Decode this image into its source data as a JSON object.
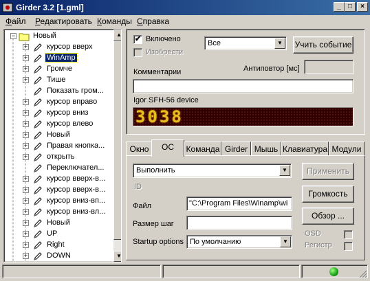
{
  "window": {
    "title": "Girder 3.2 [1.gml]",
    "minimize": "_",
    "maximize": "□",
    "close": "×"
  },
  "menu": [
    "Файл",
    "Редактировать",
    "Команды",
    "Справка"
  ],
  "tree": {
    "root": "Новый",
    "items": [
      {
        "label": "курсор вверх",
        "expandable": true
      },
      {
        "label": "WinAmp",
        "expandable": true,
        "selected": true
      },
      {
        "label": "Громче",
        "expandable": true
      },
      {
        "label": "Тише",
        "expandable": true
      },
      {
        "label": "Показать гром...",
        "expandable": false
      },
      {
        "label": "курсор вправо",
        "expandable": true
      },
      {
        "label": "курсор вниз",
        "expandable": true
      },
      {
        "label": "курсор влево",
        "expandable": true
      },
      {
        "label": "Новый",
        "expandable": true
      },
      {
        "label": "Правая кнопка...",
        "expandable": true
      },
      {
        "label": "открыть",
        "expandable": true
      },
      {
        "label": "Переключател...",
        "expandable": false
      },
      {
        "label": "курсор вверх-в...",
        "expandable": true
      },
      {
        "label": "курсор вверх-в...",
        "expandable": true
      },
      {
        "label": "курсор вниз-вп...",
        "expandable": true
      },
      {
        "label": "курсор вниз-вл...",
        "expandable": true
      },
      {
        "label": "Новый",
        "expandable": true
      },
      {
        "label": "UP",
        "expandable": true
      },
      {
        "label": "Right",
        "expandable": true
      },
      {
        "label": "DOWN",
        "expandable": true
      }
    ]
  },
  "top_panel": {
    "enabled_label": "Включено",
    "enabled_checked": "✔",
    "invert_label": "Изобрести",
    "device_combo": "Все",
    "learn_button": "Учить событие",
    "comments_label": "Комментарии",
    "repeat_label": "Антиповтор [мс]",
    "device_name": "Igor SFH-56 device",
    "led_code": "3038"
  },
  "tabs": [
    "Окно",
    "ОС",
    "Команда",
    "Girder",
    "Мышь",
    "Клавиатура",
    "Модули"
  ],
  "active_tab": "ОС",
  "os_panel": {
    "action_combo": "Выполнить",
    "id_label": "ID",
    "apply_button": "Применить",
    "volume_button": "Громкость",
    "file_label": "Файл",
    "file_value": "\"C:\\Program Files\\Winamp\\wi",
    "browse_button": "Обзор ...",
    "step_label": "Размер шаг",
    "osd_label": "OSD",
    "startup_label": "Startup options",
    "startup_combo": "По умолчанию",
    "registry_label": "Регистр"
  },
  "colors": {
    "titlebar_start": "#0a246a",
    "titlebar_end": "#3a6ea5",
    "led_background": "#300000",
    "led_digits": "#e0c020",
    "status_led": "#18a018"
  }
}
